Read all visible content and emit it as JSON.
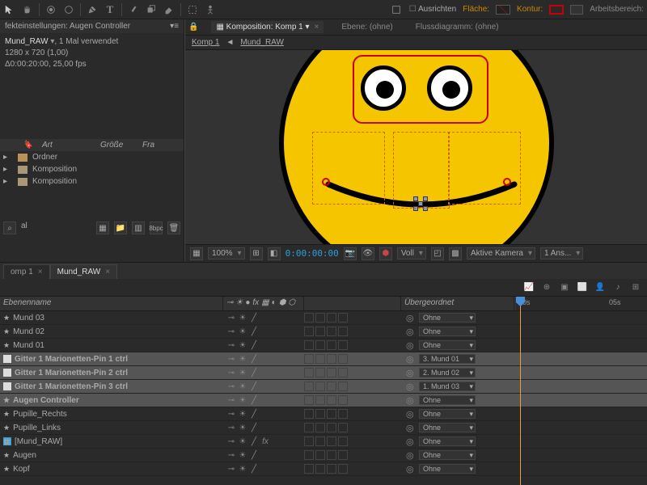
{
  "toolbar": {
    "align": "Ausrichten",
    "fill": "Fläche:",
    "stroke": "Kontur:",
    "workspace": "Arbeitsbereich:"
  },
  "effect_panel": {
    "title": "fekteinstellungen: Augen Controller",
    "name": "Mund_RAW",
    "usage": ", 1 Mal verwendet",
    "dims": "1280 x 720 (1,00)",
    "duration": "Δ0:00:20:00, 25,00 fps"
  },
  "project": {
    "cols": {
      "type": "Art",
      "size": "Größe",
      "fr": "Fra"
    },
    "items": [
      {
        "icon": "folder",
        "label": "Ordner"
      },
      {
        "icon": "comp",
        "label": "Komposition"
      },
      {
        "icon": "comp",
        "label": "Komposition"
      }
    ],
    "footer_label": "al"
  },
  "viewer": {
    "tabs": [
      {
        "label": "Komposition: Komp 1",
        "active": true
      },
      {
        "label": "Ebene: (ohne)",
        "active": false
      },
      {
        "label": "Flussdiagramm: (ohne)",
        "active": false
      }
    ],
    "breadcrumb": [
      "Komp 1",
      "Mund_RAW"
    ],
    "footer": {
      "zoom": "100%",
      "time": "0:00:00:00",
      "res": "Voll",
      "camera": "Aktive Kamera",
      "views": "1 Ans..."
    }
  },
  "timeline": {
    "tabs": [
      {
        "label": "omp 1",
        "active": false
      },
      {
        "label": "Mund_RAW",
        "active": true
      }
    ],
    "header": {
      "name": "Ebenenname",
      "parent": "Übergeordnet"
    },
    "ruler": [
      "0s",
      "05s"
    ],
    "layers": [
      {
        "icon": "star",
        "name": "Mund 03",
        "parent": "Ohne",
        "color": "#b85050",
        "fx": false,
        "sel": false
      },
      {
        "icon": "star",
        "name": "Mund 02",
        "parent": "Ohne",
        "color": "#b85050",
        "fx": false,
        "sel": false
      },
      {
        "icon": "star",
        "name": "Mund 01",
        "parent": "Ohne",
        "color": "#b85050",
        "fx": false,
        "sel": false
      },
      {
        "icon": "sq",
        "name": "Gitter 1 Marionetten-Pin 1 ctrl",
        "parent": "3. Mund 01",
        "color": "#6a7fc4",
        "fx": false,
        "sel": true
      },
      {
        "icon": "sq",
        "name": "Gitter 1 Marionetten-Pin 2 ctrl",
        "parent": "2. Mund 02",
        "color": "#6a7fc4",
        "fx": false,
        "sel": true
      },
      {
        "icon": "sq",
        "name": "Gitter 1 Marionetten-Pin 3 ctrl",
        "parent": "1. Mund 03",
        "color": "#6a7fc4",
        "fx": false,
        "sel": true
      },
      {
        "icon": "star",
        "name": "Augen Controller",
        "parent": "Ohne",
        "color": "#6a7fc4",
        "fx": false,
        "sel": true
      },
      {
        "icon": "star",
        "name": "Pupille_Rechts",
        "parent": "Ohne",
        "color": "#6a7fc4",
        "fx": false,
        "sel": false
      },
      {
        "icon": "star",
        "name": "Pupille_Links",
        "parent": "Ohne",
        "color": "#6a7fc4",
        "fx": false,
        "sel": false
      },
      {
        "icon": "comp",
        "name": "[Mund_RAW]",
        "parent": "Ohne",
        "color": "#5a9a6a",
        "fx": true,
        "sel": false
      },
      {
        "icon": "star",
        "name": "Augen",
        "parent": "Ohne",
        "color": "#6a7fc4",
        "fx": false,
        "sel": false
      },
      {
        "icon": "star",
        "name": "Kopf",
        "parent": "Ohne",
        "color": "#4a7fa8",
        "fx": false,
        "sel": false
      }
    ]
  }
}
